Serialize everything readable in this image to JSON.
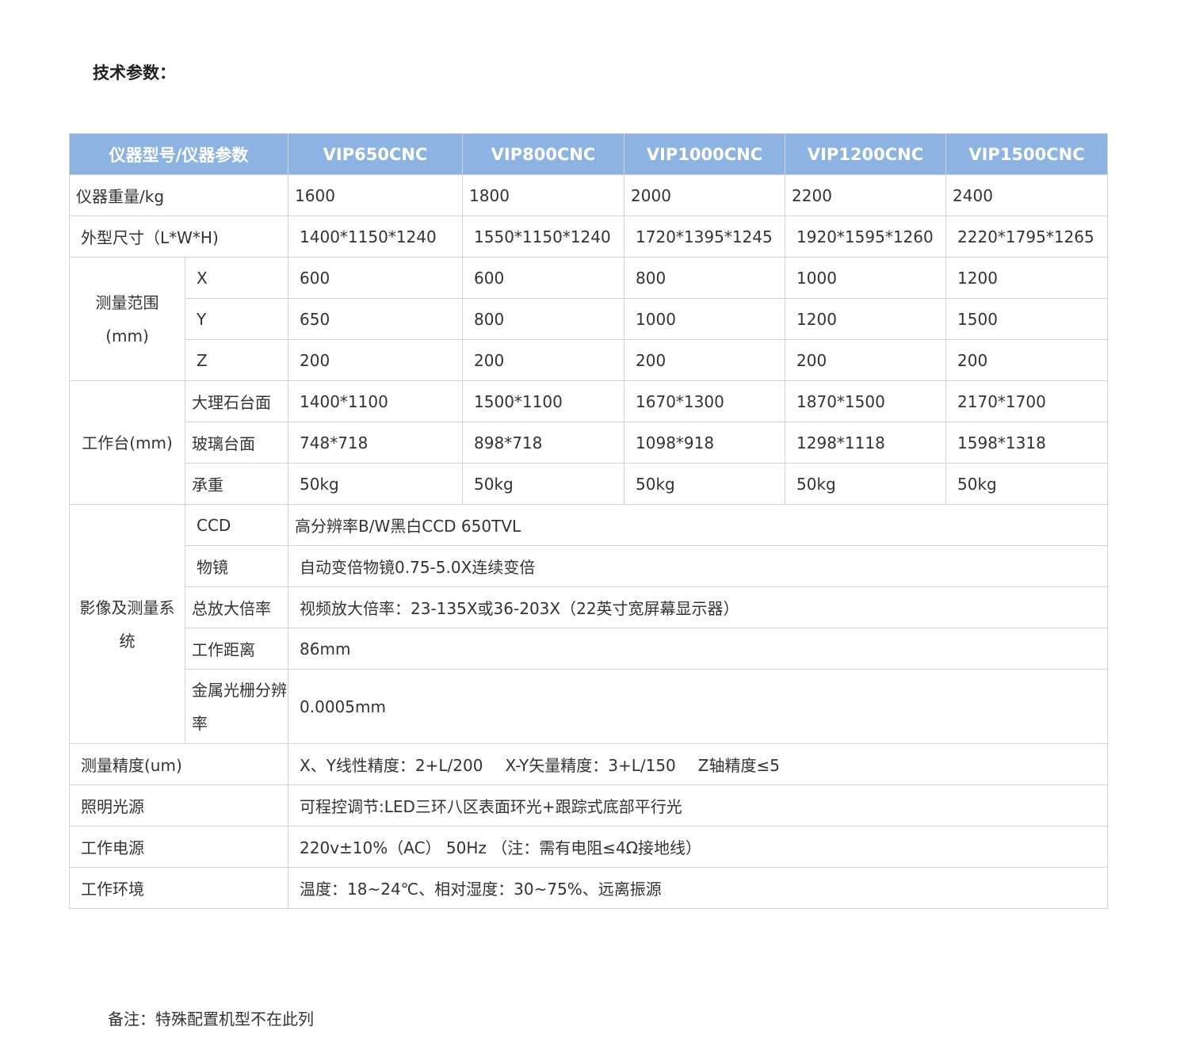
{
  "heading": "技术参数：",
  "header": {
    "col0": "仪器型号/仪器参数",
    "models": [
      "VIP650CNC",
      "VIP800CNC",
      "VIP1000CNC",
      "VIP1200CNC",
      "VIP1500CNC"
    ]
  },
  "weight": {
    "label": "仪器重量/kg",
    "values": [
      "1600",
      "1800",
      "2000",
      "2200",
      "2400"
    ]
  },
  "dimensions": {
    "label": "外型尺寸（L*W*H)",
    "values": [
      "1400*1150*1240",
      "1550*1150*1240",
      "1720*1395*1245",
      "1920*1595*1260",
      "2220*1795*1265"
    ]
  },
  "range": {
    "label_line1": "测量范围",
    "label_line2": "(mm)",
    "x": {
      "label": "X",
      "values": [
        "600",
        "600",
        "800",
        "1000",
        "1200"
      ]
    },
    "y": {
      "label": "Y",
      "values": [
        "650",
        "800",
        "1000",
        "1200",
        "1500"
      ]
    },
    "z": {
      "label": "Z",
      "values": [
        "200",
        "200",
        "200",
        "200",
        "200"
      ]
    }
  },
  "table_stage": {
    "label": "工作台(mm)",
    "marble": {
      "label": "大理石台面",
      "values": [
        "1400*1100",
        "1500*1100",
        "1670*1300",
        "1870*1500",
        "2170*1700"
      ]
    },
    "glass": {
      "label": "玻璃台面",
      "values": [
        "748*718",
        "898*718",
        "1098*918",
        "1298*1118",
        "1598*1318"
      ]
    },
    "load": {
      "label": "承重",
      "values": [
        "50kg",
        "50kg",
        "50kg",
        "50kg",
        "50kg"
      ]
    }
  },
  "imaging": {
    "label": "影像及测量系统",
    "ccd": {
      "label": "CCD",
      "value": "高分辨率B/W黑白CCD 650TVL"
    },
    "lens": {
      "label": "物镜",
      "value": "自动变倍物镜0.75-5.0X连续变倍"
    },
    "magnification": {
      "label": "总放大倍率",
      "value": "视频放大倍率：23-135X或36-203X（22英寸宽屏幕显示器）"
    },
    "working_distance": {
      "label": "工作距离",
      "value": "86mm"
    },
    "grating": {
      "label": "金属光栅分辨率",
      "value": "0.0005mm"
    }
  },
  "accuracy": {
    "label": "测量精度(um)",
    "xy_linear": "X、Y线性精度：2+L/200",
    "xy_vector": "X-Y矢量精度：3+L/150",
    "z_axis": "Z轴精度≤5"
  },
  "lighting": {
    "label": "照明光源",
    "value": "可程控调节:LED三环八区表面环光+跟踪式底部平行光"
  },
  "power": {
    "label": "工作电源",
    "value": "220v±10%（AC） 50Hz （注：需有电阻≤4Ω接地线）"
  },
  "environment": {
    "label": "工作环境",
    "value": "温度：18~24℃、相对湿度：30~75%、远离振源"
  },
  "note": "备注：特殊配置机型不在此列"
}
